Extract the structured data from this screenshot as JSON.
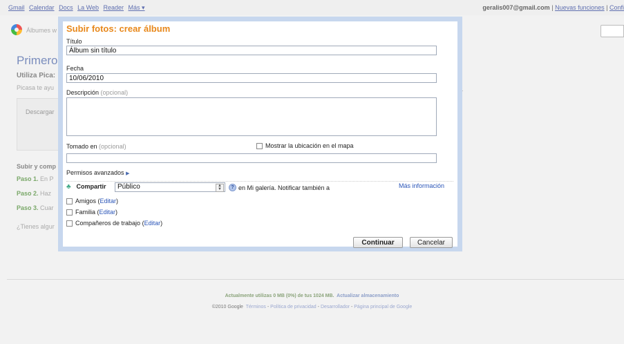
{
  "topnav": {
    "links": [
      "Gmail",
      "Calendar",
      "Docs",
      "La Web",
      "Reader",
      "Más ▾"
    ],
    "email": "geralis007@gmail.com",
    "separator": "|",
    "new_features": "Nuevas funciones",
    "settings": "Confi"
  },
  "header": {
    "albums_link": "Álbumes w"
  },
  "background": {
    "title": "Primeros",
    "subtitle": "Utiliza Pica:",
    "subtitle2": "Picasa te ayu",
    "box_label": "Descargar",
    "upload_heading": "Subir y comp",
    "steps": [
      {
        "label": "Paso 1.",
        "text": "En P"
      },
      {
        "label": "Paso 2.",
        "text": "Haz"
      },
      {
        "label": "Paso 3.",
        "text": "Cuar"
      }
    ],
    "question": "¿Tienes algur",
    "dot": "."
  },
  "dialog": {
    "title": "Subir fotos: crear álbum",
    "title_label": "Título",
    "title_value": "Álbum sin título",
    "date_label": "Fecha",
    "date_value": "10/06/2010",
    "description_label": "Descripción",
    "optional": "(opcional)",
    "taken_label": "Tomado en",
    "show_map_label": "Mostrar la ubicación en el mapa",
    "advanced_permissions": "Permisos avanzados",
    "share_label": "Compartir",
    "share_value": "Público",
    "share_note": "en Mi galería. Notificar también a",
    "more_info": "Más información",
    "groups": [
      {
        "name": "Amigos",
        "edit": "Editar"
      },
      {
        "name": "Familia",
        "edit": "Editar"
      },
      {
        "name": "Compañeros de trabajo",
        "edit": "Editar"
      }
    ],
    "continue_button": "Continuar",
    "cancel_button": "Cancelar"
  },
  "footer": {
    "usage_text": "Actualmente utilizas 0 MB (0%) de tus 1024 MB.",
    "upgrade_link": "Actualizar almacenamiento",
    "copyright": "©2010 Google",
    "links": [
      "Términos",
      "Política de privacidad",
      "Desarrollador",
      "Página principal de Google"
    ],
    "dash": "-"
  }
}
